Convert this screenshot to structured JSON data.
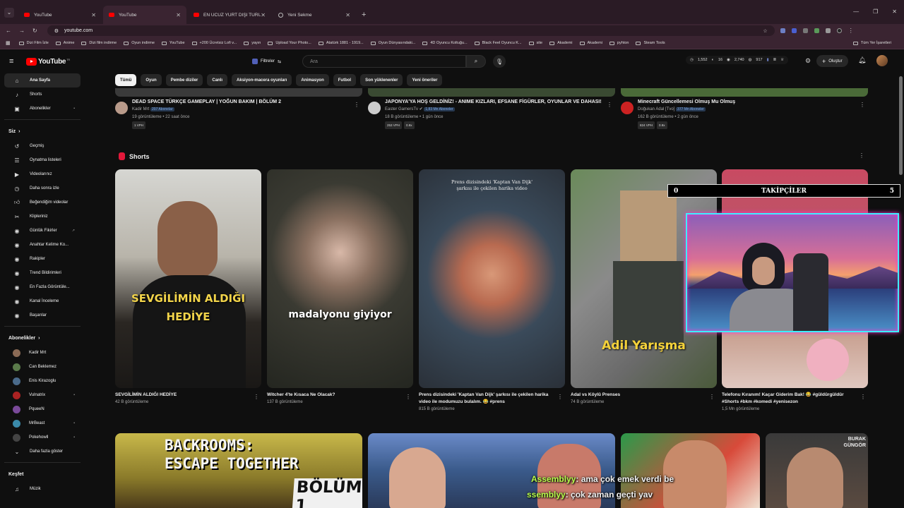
{
  "browser": {
    "tabs": [
      {
        "label": "YouTube",
        "icon": "youtube-favicon"
      },
      {
        "label": "YouTube",
        "icon": "youtube-favicon"
      },
      {
        "label": "EN UCUZ YURT DIŞI TURU! - Yo",
        "icon": "youtube-favicon"
      },
      {
        "label": "Yeni Sekme",
        "icon": "globe-icon"
      }
    ],
    "url": "youtube.com",
    "bookmarks": [
      "Dizi Film İzle",
      "Anime",
      "Dizi film indirme",
      "Oyun indirme",
      "YouTube",
      "+200 Ücretsiz Lofi v...",
      "yayın",
      "Upload Your Photo...",
      "Atatürk 1881 - 1919...",
      "Oyun Dünyasındaki...",
      "4D Oyuncu Koltuğu...",
      "Black Feel Oyuncu K...",
      "site",
      "Akademi",
      "Akademi",
      "pyhton",
      "Steam Tools"
    ],
    "bookmarks_right": "Tüm Yer İşaretleri"
  },
  "header": {
    "logo": "YouTube",
    "logo_sup": "TR",
    "filters": "Filtreler",
    "search_placeholder": "Ara",
    "stats": [
      "1,552",
      "16",
      "2,740",
      "917"
    ],
    "create": "Oluştur"
  },
  "sidebar": {
    "main": [
      {
        "label": "Ana Sayfa",
        "icon": "home-icon"
      },
      {
        "label": "Shorts",
        "icon": "shorts-icon"
      },
      {
        "label": "Abonelikler",
        "icon": "subscriptions-icon"
      }
    ],
    "you_title": "Siz",
    "you": [
      {
        "label": "Geçmiş"
      },
      {
        "label": "Oynatma listeleri"
      },
      {
        "label": "Videolarınız"
      },
      {
        "label": "Daha sonra izle"
      },
      {
        "label": "Beğendiğim videolar"
      },
      {
        "label": "Klipleriniz"
      },
      {
        "label": "Günlük Fikirler"
      },
      {
        "label": "Anahtar Kelime Ko..."
      },
      {
        "label": "Rakipler"
      },
      {
        "label": "Trend Bildirimleri"
      },
      {
        "label": "En Fazla Görüntüle..."
      },
      {
        "label": "Kanal İnceleme"
      },
      {
        "label": "Başarılar"
      }
    ],
    "subs_title": "Abonelikler",
    "subs": [
      {
        "label": "Kadir Mrt",
        "color": "#8a6a55"
      },
      {
        "label": "Can Beklemez",
        "color": "#5a7a4a"
      },
      {
        "label": "Enis Kirazoglu",
        "color": "#4a6a8a"
      },
      {
        "label": "Vulnatrix",
        "color": "#aa2222"
      },
      {
        "label": "PqueeN",
        "color": "#7a4a9a"
      },
      {
        "label": "MrBeast",
        "color": "#3a8aaa"
      },
      {
        "label": "Pokehowll",
        "color": "#444444"
      }
    ],
    "more": "Daha fazla göster",
    "explore_title": "Keşfet",
    "explore": [
      {
        "label": "Müzik"
      }
    ]
  },
  "chips": [
    "Tümü",
    "Oyun",
    "Pembe diziler",
    "Canlı",
    "Aksiyon-macera oyunları",
    "Animasyon",
    "Futbol",
    "Son yüklenenler",
    "Yeni öneriler"
  ],
  "videos": [
    {
      "title": "DEAD SPACE TÜRKÇE GAMEPLAY | YOĞUN BAKIM | BÖLÜM 2",
      "channel": "Kadir Mrt",
      "subs": "207 Abonelar",
      "meta": "19 görüntüleme • 22 saat önce",
      "pills": [
        "1 VPH"
      ],
      "color": "#b89a8a"
    },
    {
      "title": "JAPONYA'YA HOŞ GELDİNİZ! - ANIME KIZLARI, EFSANE FİGÜRLER, OYUNLAR VE DAHASI!",
      "channel": "Easter GamersTv",
      "subs": "1,83 Mn Aboneler",
      "meta": "18 B görüntüleme • 1 gün önce",
      "pills": [
        "253 VPH",
        "0.9x"
      ],
      "color": "#cccccc"
    },
    {
      "title": "Minecraft Güncellemesi Olmuş Mu Olmuş",
      "channel": "Doğukan Adal [Tvo]",
      "subs": "377 Mn Aboneler",
      "meta": "162 B görüntüleme • 2 gün önce",
      "pills": [
        "824 VPH",
        "0.9x"
      ],
      "color": "#cc2222"
    }
  ],
  "shorts_title": "Shorts",
  "shorts": [
    {
      "caption": "SEVGİLİMİN ALDIĞI HEDİYE",
      "title": "SEVGİLİMİN ALDIĞI HEDİYE",
      "views": "42 B görüntüleme"
    },
    {
      "caption": "madalyonu giyiyor",
      "title": "Witcher 4'te Kısaca Ne Olacak?",
      "views": "137 B görüntüleme"
    },
    {
      "caption": "Prens dizisindeki 'Kaptan Van Dijk' şarkısı ile çekilen harika video",
      "title": "Prens dizisindeki 'Kaptan Van Dijk' şarkısı ile çekilen harika video ile modumuzu bulalım. 😂 #prens",
      "views": "815 B görüntüleme"
    },
    {
      "caption": "Adil Yarışma",
      "title": "Adal vs Köylü Prenses",
      "views": "74 B görüntüleme"
    },
    {
      "caption": "",
      "title": "Telefonu Kıranım! Kaçar Giderim Bak! 😂 #güldürgüldür #Shorts #bkm #komedi #yenisezon",
      "views": "1,5 Mn görüntüleme"
    }
  ],
  "bottom_row": [
    {
      "caption_line1": "BACKROOMS:",
      "caption_line2": "ESCAPE TOGETHER",
      "caption_line3": "BÖLÜM 1"
    },
    {
      "caption_line1": ""
    },
    {
      "caption_line1": ""
    },
    {
      "caption_line1": "BURAK GÜNGÖR"
    }
  ],
  "stream_overlay": {
    "follower_left": "0",
    "follower_label": "TAKİPÇİLER",
    "follower_right": "5"
  },
  "chat": [
    {
      "name": "Assemblyy",
      "text": ": ama çok emek verdi be"
    },
    {
      "name": "ssemblyy",
      "text": ": çok zaman geçti yav"
    }
  ]
}
